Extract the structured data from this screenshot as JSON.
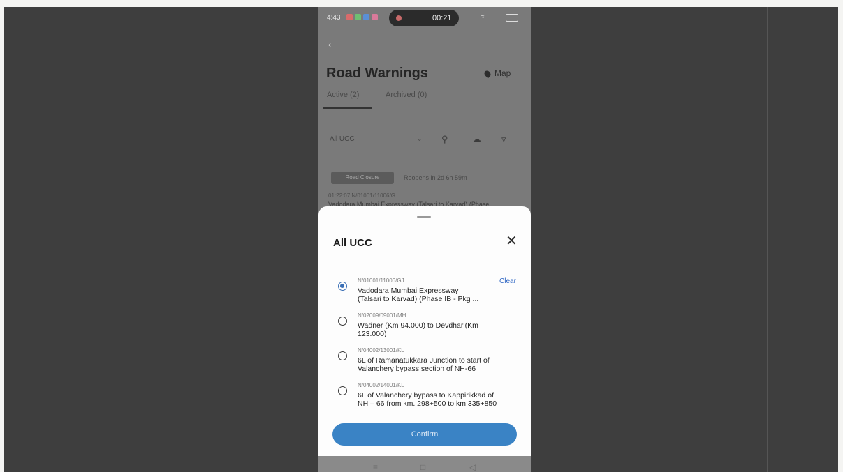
{
  "status_bar": {
    "time": "4:43",
    "recording_timer": "00:21",
    "notification_colors": [
      "#d96b6b",
      "#6fbf72",
      "#5a8fd6",
      "#d97a9a"
    ]
  },
  "header": {
    "title": "Road Warnings",
    "map_label": "Map"
  },
  "tabs": [
    {
      "label": "Active (2)",
      "active": true
    },
    {
      "label": "Archived (0)",
      "active": false
    }
  ],
  "filter_bar": {
    "selected": "All UCC",
    "icons": [
      "chevron-down-icon",
      "search-icon",
      "download-icon",
      "filter-icon"
    ]
  },
  "background_card": {
    "chip_label": "Road Closure",
    "reopens_text": "Reopens in 2d 6h 59m",
    "code_line": "01:22:07   N/01001/11006/G...",
    "title_line": "Vadodara Mumbai Expressway (Talsari to Karvad) (Phase"
  },
  "sheet": {
    "title": "All UCC",
    "clear_label": "Clear",
    "confirm_label": "Confirm",
    "options": [
      {
        "code": "N/01001/11006/GJ",
        "line1": "Vadodara Mumbai Expressway",
        "line2": "(Talsari to Karvad) (Phase IB - Pkg ...",
        "selected": true
      },
      {
        "code": "N/02009/09001/MH",
        "line1": "Wadner (Km 94.000) to Devdhari(Km",
        "line2": "123.000)",
        "selected": false
      },
      {
        "code": "N/04002/13001/KL",
        "line1": "6L of Ramanatukkara Junction to start of",
        "line2": "Valanchery bypass section of NH-66",
        "selected": false
      },
      {
        "code": "N/04002/14001/KL",
        "line1": "6L of Valanchery bypass to Kappirikkad of",
        "line2": "NH – 66 from km. 298+500 to km 335+850",
        "selected": false
      }
    ]
  },
  "colors": {
    "accent": "#3a83c5",
    "link": "#2f66c3",
    "scrim": "#3e3e3e"
  }
}
